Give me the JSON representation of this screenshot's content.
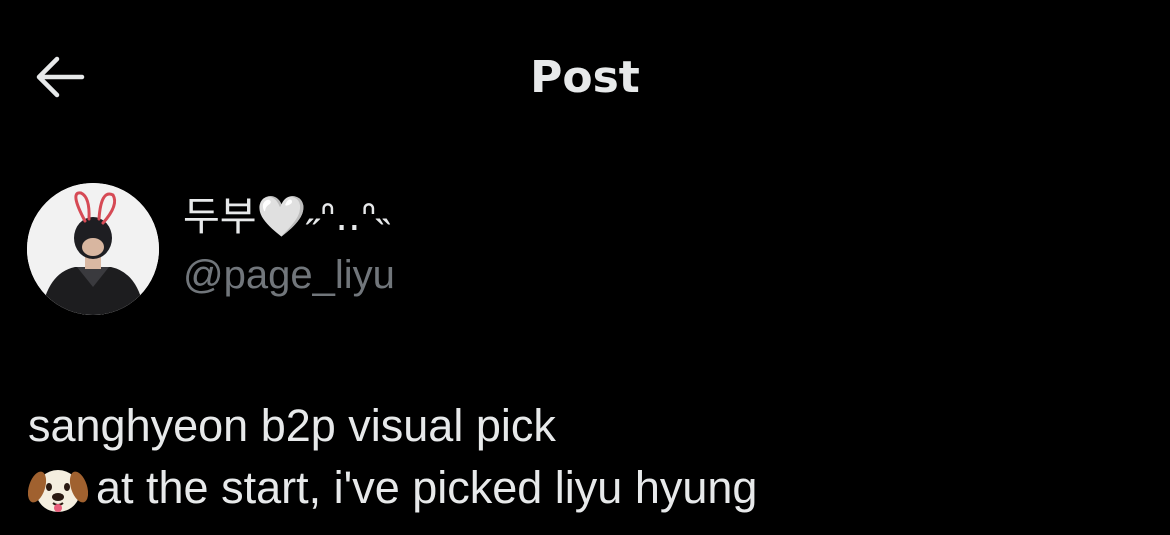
{
  "header": {
    "back_icon": "arrow-left-icon",
    "title": "Post"
  },
  "author": {
    "display_name": "두부🤍˶ᐢ..ᐢ˵",
    "handle": "@page_liyu",
    "avatar": "avatar-photo"
  },
  "post": {
    "lines": [
      {
        "text": "sanghyeon b2p visual pick"
      },
      {
        "emoji": "dog-face-icon",
        "text": "at the start, i've picked liyu hyung"
      }
    ]
  },
  "colors": {
    "background": "#000000",
    "primary_text": "#e7e9ea",
    "secondary_text": "#71767b"
  }
}
